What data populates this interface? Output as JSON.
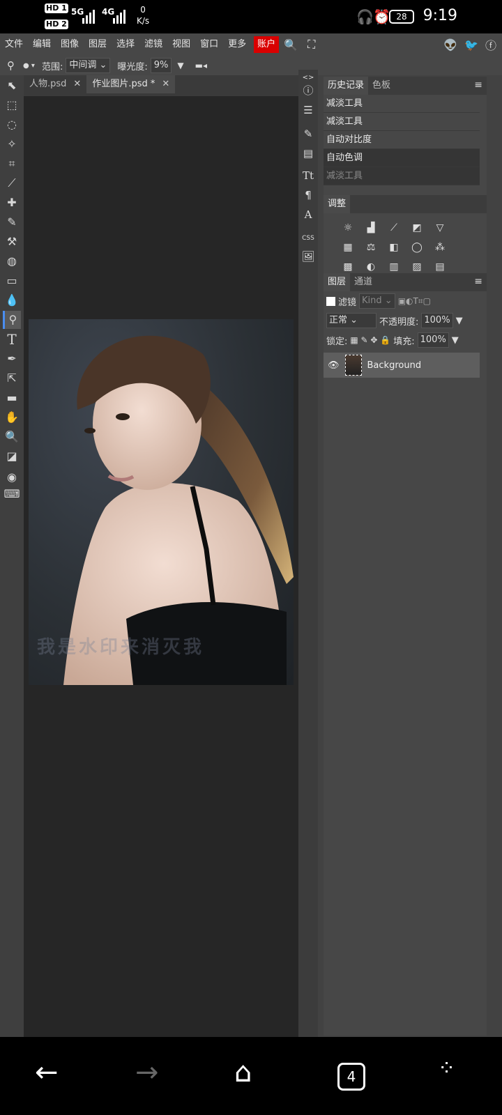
{
  "status": {
    "hd1": "HD 1",
    "hd2": "HD 2",
    "net1": "5G",
    "net2": "4G",
    "speed_value": "0",
    "speed_unit": "K/s",
    "battery": "28",
    "time": "9:19"
  },
  "menu": [
    "文件",
    "编辑",
    "图像",
    "图层",
    "选择",
    "滤镜",
    "视图",
    "窗口",
    "更多"
  ],
  "account_label": "账户",
  "options": {
    "range_label": "范围:",
    "range_value": "中间调",
    "exposure_label": "曝光度:",
    "exposure_value": "9%",
    "brush_size": "15"
  },
  "tabs": [
    {
      "label": "人物.psd",
      "close": "✕"
    },
    {
      "label": "作业图片.psd *",
      "close": "✕"
    }
  ],
  "watermark": "我是水印来消灭我",
  "history_panel": {
    "tab_history": "历史记录",
    "tab_swatches": "色板",
    "items": [
      "减淡工具",
      "减淡工具",
      "自动对比度",
      "自动色调",
      "减淡工具"
    ]
  },
  "adjust_panel": {
    "title": "调整"
  },
  "layers_panel": {
    "tab_layers": "图层",
    "tab_channels": "通道",
    "filter_label": "滤镜",
    "kind_value": "Kind",
    "blend_mode": "正常",
    "opacity_label": "不透明度:",
    "opacity_value": "100%",
    "lock_label": "锁定:",
    "fill_label": "填充:",
    "fill_value": "100%",
    "layer_name": "Background"
  },
  "navbar": {
    "recents_count": "4"
  },
  "colors": {
    "accent": "#4a8df0",
    "account_bg": "#d90000",
    "panel_bg": "#474747",
    "canvas_bg": "#262626"
  }
}
